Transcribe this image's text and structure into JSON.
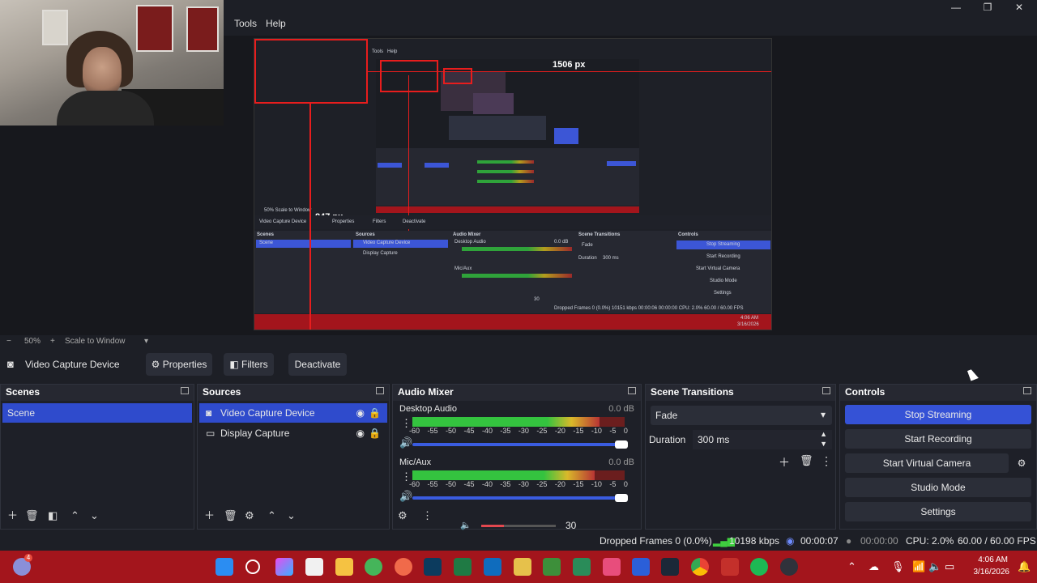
{
  "menu": {
    "tools": "Tools",
    "help": "Help"
  },
  "window_controls": {
    "minimize": "—",
    "maximize": "❐",
    "close": "✕"
  },
  "preview": {
    "label_width": "1506 px",
    "label_height": "847 px",
    "inner_menu": {
      "tools": "Tools",
      "help": "Help"
    },
    "inner_source": "Video Capture Device",
    "inner_scale": "50%   Scale to Window",
    "inner_mixer": "Audio Mixer",
    "inner_transitions": "Scene Transitions",
    "inner_controls": "Controls",
    "inner_scenes": "Scenes",
    "inner_sources": "Sources",
    "inner_scene": "Scene",
    "inner_src1": "Video Capture Device",
    "inner_src2": "Display Capture",
    "inner_desktop": "Desktop Audio",
    "inner_mic": "Mic/Aux",
    "inner_fade": "Fade",
    "inner_duration": "Duration",
    "inner_ms": "300 ms",
    "inner_stop": "Stop Streaming",
    "inner_rec": "Start Recording",
    "inner_vcam": "Start Virtual Camera",
    "inner_studio": "Studio Mode",
    "inner_settings": "Settings",
    "inner_props": "Properties",
    "inner_filters": "Filters",
    "inner_deactivate": "Deactivate",
    "inner_db": "0.0 dB",
    "inner_status": "Dropped Frames 0 (0.0%)   10151 kbps   00:00:06   00:00:00   CPU: 2.0%   60.00 / 60.00 FPS",
    "inner_clock_time": "4:06 AM",
    "inner_clock_date": "3/16/2026",
    "inner_vol": "30"
  },
  "preview_bar": {
    "minus": "−",
    "zoom": "50%",
    "plus": "+",
    "scale": "Scale to Window"
  },
  "source_bar": {
    "source_name": "Video Capture Device",
    "properties": "Properties",
    "filters": "Filters",
    "deactivate": "Deactivate"
  },
  "scenes": {
    "title": "Scenes",
    "items": [
      "Scene"
    ]
  },
  "sources": {
    "title": "Sources",
    "items": [
      "Video Capture Device",
      "Display Capture"
    ]
  },
  "mixer": {
    "title": "Audio Mixer",
    "channels": [
      {
        "name": "Desktop Audio",
        "db": "0.0 dB",
        "level": 0.88
      },
      {
        "name": "Mic/Aux",
        "db": "0.0 dB",
        "level": 0.86
      }
    ],
    "ticks": [
      "-60",
      "-55",
      "-50",
      "-45",
      "-40",
      "-35",
      "-30",
      "-25",
      "-20",
      "-15",
      "-10",
      "-5",
      "0"
    ],
    "volume": "30"
  },
  "transitions": {
    "title": "Scene Transitions",
    "type": "Fade",
    "duration_label": "Duration",
    "duration_value": "300 ms"
  },
  "controls": {
    "title": "Controls",
    "stop_streaming": "Stop Streaming",
    "start_recording": "Start Recording",
    "start_virtual_camera": "Start Virtual Camera",
    "studio_mode": "Studio Mode",
    "settings": "Settings"
  },
  "status": {
    "dropped": "Dropped Frames 0 (0.0%)",
    "bitrate": "10198 kbps",
    "stream_time": "00:00:07",
    "rec_time": "00:00:00",
    "cpu": "CPU: 2.0%",
    "fps": "60.00 / 60.00 FPS"
  },
  "taskbar": {
    "time": "4:06 AM",
    "date": "3/16/2026",
    "badge": "4"
  },
  "colors": {
    "accent": "#3552d6",
    "taskbar": "#a3151c",
    "selection": "#e81d1d"
  }
}
